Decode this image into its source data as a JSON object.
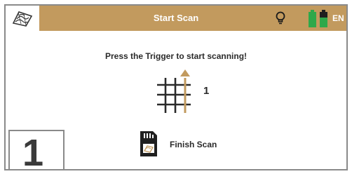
{
  "header": {
    "title": "Start Scan",
    "language": "EN",
    "logo_icon": "terrain-map-icon",
    "bulb_icon": "light-bulb-icon",
    "battery_icon": "battery-icon",
    "accent_color": "#c29a5e",
    "battery_color": "#2ea84a"
  },
  "main": {
    "prompt": "Press the Trigger to start scanning!",
    "scan_grid_icon": "scan-grid-arrow-icon",
    "line_count": "1",
    "finish_icon": "sd-card-icon",
    "finish_label": "Finish Scan"
  },
  "step_badge": "1"
}
